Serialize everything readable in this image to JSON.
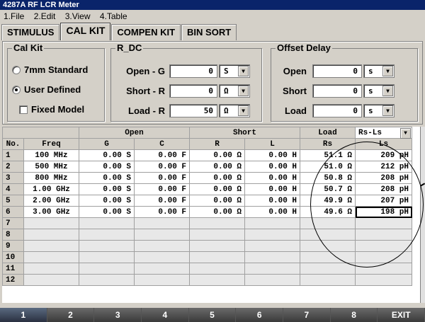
{
  "window": {
    "title": "4287A RF LCR Meter"
  },
  "menu": [
    "1.File",
    "2.Edit",
    "3.View",
    "4.Table"
  ],
  "tabs": [
    "STIMULUS",
    "CAL KIT",
    "COMPEN KIT",
    "BIN SORT"
  ],
  "active_tab": "CAL KIT",
  "cal_kit": {
    "label": "Cal Kit",
    "opt_7mm": "7mm Standard",
    "opt_user": "User Defined",
    "fixed_model": "Fixed Model"
  },
  "r_dc": {
    "label": "R_DC",
    "open_label": "Open - G",
    "open_value": "0",
    "open_unit": "S",
    "short_label": "Short - R",
    "short_value": "0",
    "short_unit": "Ω",
    "load_label": "Load - R",
    "load_value": "50",
    "load_unit": "Ω"
  },
  "offset_delay": {
    "label": "Offset Delay",
    "open_label": "Open",
    "open_value": "0",
    "open_unit": "s",
    "short_label": "Short",
    "short_value": "0",
    "short_unit": "s",
    "load_label": "Load",
    "load_value": "0",
    "load_unit": "s"
  },
  "table": {
    "group_open": "Open",
    "group_short": "Short",
    "group_load": "Load",
    "load_mode": "Rs-Ls",
    "col_no": "No.",
    "col_freq": "Freq",
    "col_g": "G",
    "col_c": "C",
    "col_r": "R",
    "col_l": "L",
    "col_rs": "Rs",
    "col_ls": "Ls",
    "rows": [
      {
        "no": "1",
        "freq": "100 MHz",
        "g": "0.00 S",
        "c": "0.00 F",
        "r": "0.00 Ω",
        "l": "0.00 H",
        "rs": "51.1 Ω",
        "ls": "209 pH"
      },
      {
        "no": "2",
        "freq": "500 MHz",
        "g": "0.00 S",
        "c": "0.00 F",
        "r": "0.00 Ω",
        "l": "0.00 H",
        "rs": "51.0 Ω",
        "ls": "212 pH"
      },
      {
        "no": "3",
        "freq": "800 MHz",
        "g": "0.00 S",
        "c": "0.00 F",
        "r": "0.00 Ω",
        "l": "0.00 H",
        "rs": "50.8 Ω",
        "ls": "208 pH"
      },
      {
        "no": "4",
        "freq": "1.00 GHz",
        "g": "0.00 S",
        "c": "0.00 F",
        "r": "0.00 Ω",
        "l": "0.00 H",
        "rs": "50.7 Ω",
        "ls": "208 pH"
      },
      {
        "no": "5",
        "freq": "2.00 GHz",
        "g": "0.00 S",
        "c": "0.00 F",
        "r": "0.00 Ω",
        "l": "0.00 H",
        "rs": "49.9 Ω",
        "ls": "207 pH"
      },
      {
        "no": "6",
        "freq": "3.00 GHz",
        "g": "0.00 S",
        "c": "0.00 F",
        "r": "0.00 Ω",
        "l": "0.00 H",
        "rs": "49.6 Ω",
        "ls": "198 pH"
      },
      {
        "no": "7"
      },
      {
        "no": "8"
      },
      {
        "no": "9"
      },
      {
        "no": "10"
      },
      {
        "no": "11"
      },
      {
        "no": "12"
      }
    ]
  },
  "footer": [
    "1",
    "2",
    "3",
    "4",
    "5",
    "6",
    "7",
    "8",
    "EXIT"
  ]
}
